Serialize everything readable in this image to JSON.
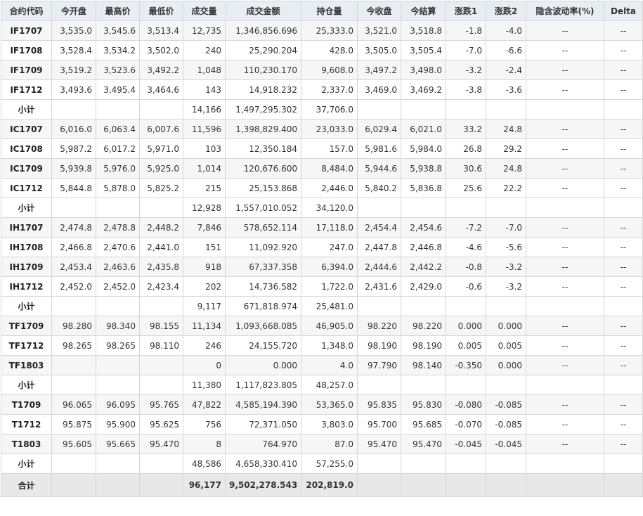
{
  "headers": [
    "合约代码",
    "今开盘",
    "最高价",
    "最低价",
    "成交量",
    "成交金额",
    "持仓量",
    "今收盘",
    "今结算",
    "涨跌1",
    "涨跌2",
    "隐含波动率(%)",
    "Delta"
  ],
  "rows": [
    {
      "kind": "data",
      "cells": [
        "IF1707",
        "3,535.0",
        "3,545.6",
        "3,513.4",
        "12,735",
        "1,346,856.696",
        "25,333.0",
        "3,521.0",
        "3,518.8",
        "-1.8",
        "-4.0",
        "--",
        "--"
      ]
    },
    {
      "kind": "data",
      "cells": [
        "IF1708",
        "3,528.4",
        "3,534.2",
        "3,502.0",
        "240",
        "25,290.204",
        "428.0",
        "3,505.0",
        "3,505.4",
        "-7.0",
        "-6.6",
        "--",
        "--"
      ]
    },
    {
      "kind": "data",
      "cells": [
        "IF1709",
        "3,519.2",
        "3,523.6",
        "3,492.2",
        "1,048",
        "110,230.170",
        "9,608.0",
        "3,497.2",
        "3,498.0",
        "-3.2",
        "-2.4",
        "--",
        "--"
      ]
    },
    {
      "kind": "data",
      "cells": [
        "IF1712",
        "3,493.6",
        "3,495.4",
        "3,464.6",
        "143",
        "14,918.232",
        "2,337.0",
        "3,469.0",
        "3,469.2",
        "-3.8",
        "-3.6",
        "--",
        "--"
      ]
    },
    {
      "kind": "subtotal",
      "cells": [
        "小计",
        "",
        "",
        "",
        "14,166",
        "1,497,295.302",
        "37,706.0",
        "",
        "",
        "",
        "",
        "",
        ""
      ]
    },
    {
      "kind": "data",
      "cells": [
        "IC1707",
        "6,016.0",
        "6,063.4",
        "6,007.6",
        "11,596",
        "1,398,829.400",
        "23,033.0",
        "6,029.4",
        "6,021.0",
        "33.2",
        "24.8",
        "--",
        "--"
      ]
    },
    {
      "kind": "data",
      "cells": [
        "IC1708",
        "5,987.2",
        "6,017.2",
        "5,971.0",
        "103",
        "12,350.184",
        "157.0",
        "5,981.6",
        "5,984.0",
        "26.8",
        "29.2",
        "--",
        "--"
      ]
    },
    {
      "kind": "data",
      "cells": [
        "IC1709",
        "5,939.8",
        "5,976.0",
        "5,925.0",
        "1,014",
        "120,676.600",
        "8,484.0",
        "5,944.6",
        "5,938.8",
        "30.6",
        "24.8",
        "--",
        "--"
      ]
    },
    {
      "kind": "data",
      "cells": [
        "IC1712",
        "5,844.8",
        "5,878.0",
        "5,825.2",
        "215",
        "25,153.868",
        "2,446.0",
        "5,840.2",
        "5,836.8",
        "25.6",
        "22.2",
        "--",
        "--"
      ]
    },
    {
      "kind": "subtotal",
      "cells": [
        "小计",
        "",
        "",
        "",
        "12,928",
        "1,557,010.052",
        "34,120.0",
        "",
        "",
        "",
        "",
        "",
        ""
      ]
    },
    {
      "kind": "data",
      "cells": [
        "IH1707",
        "2,474.8",
        "2,478.8",
        "2,448.2",
        "7,846",
        "578,652.114",
        "17,118.0",
        "2,454.4",
        "2,454.6",
        "-7.2",
        "-7.0",
        "--",
        "--"
      ]
    },
    {
      "kind": "data",
      "cells": [
        "IH1708",
        "2,466.8",
        "2,470.6",
        "2,441.0",
        "151",
        "11,092.920",
        "247.0",
        "2,447.8",
        "2,446.8",
        "-4.6",
        "-5.6",
        "--",
        "--"
      ]
    },
    {
      "kind": "data",
      "cells": [
        "IH1709",
        "2,453.4",
        "2,463.6",
        "2,435.8",
        "918",
        "67,337.358",
        "6,394.0",
        "2,444.6",
        "2,442.2",
        "-0.8",
        "-3.2",
        "--",
        "--"
      ]
    },
    {
      "kind": "data",
      "cells": [
        "IH1712",
        "2,452.0",
        "2,452.0",
        "2,423.4",
        "202",
        "14,736.582",
        "1,722.0",
        "2,431.6",
        "2,429.0",
        "-0.6",
        "-3.2",
        "--",
        "--"
      ]
    },
    {
      "kind": "subtotal",
      "cells": [
        "小计",
        "",
        "",
        "",
        "9,117",
        "671,818.974",
        "25,481.0",
        "",
        "",
        "",
        "",
        "",
        ""
      ]
    },
    {
      "kind": "data",
      "cells": [
        "TF1709",
        "98.280",
        "98.340",
        "98.155",
        "11,134",
        "1,093,668.085",
        "46,905.0",
        "98.220",
        "98.220",
        "0.000",
        "0.000",
        "--",
        "--"
      ]
    },
    {
      "kind": "data",
      "cells": [
        "TF1712",
        "98.265",
        "98.265",
        "98.110",
        "246",
        "24,155.720",
        "1,348.0",
        "98.190",
        "98.190",
        "0.005",
        "0.005",
        "--",
        "--"
      ]
    },
    {
      "kind": "data",
      "cells": [
        "TF1803",
        "",
        "",
        "",
        "0",
        "0.000",
        "4.0",
        "97.790",
        "98.140",
        "-0.350",
        "0.000",
        "--",
        "--"
      ]
    },
    {
      "kind": "subtotal",
      "cells": [
        "小计",
        "",
        "",
        "",
        "11,380",
        "1,117,823.805",
        "48,257.0",
        "",
        "",
        "",
        "",
        "",
        ""
      ]
    },
    {
      "kind": "data",
      "cells": [
        "T1709",
        "96.065",
        "96.095",
        "95.765",
        "47,822",
        "4,585,194.390",
        "53,365.0",
        "95.835",
        "95.830",
        "-0.080",
        "-0.085",
        "--",
        "--"
      ]
    },
    {
      "kind": "data",
      "cells": [
        "T1712",
        "95.875",
        "95.900",
        "95.625",
        "756",
        "72,371.050",
        "3,803.0",
        "95.700",
        "95.685",
        "-0.070",
        "-0.085",
        "--",
        "--"
      ]
    },
    {
      "kind": "data",
      "cells": [
        "T1803",
        "95.605",
        "95.665",
        "95.470",
        "8",
        "764.970",
        "87.0",
        "95.470",
        "95.470",
        "-0.045",
        "-0.045",
        "--",
        "--"
      ]
    },
    {
      "kind": "subtotal",
      "cells": [
        "小计",
        "",
        "",
        "",
        "48,586",
        "4,658,330.410",
        "57,255.0",
        "",
        "",
        "",
        "",
        "",
        ""
      ]
    },
    {
      "kind": "total",
      "cells": [
        "合计",
        "",
        "",
        "",
        "96,177",
        "9,502,278.543",
        "202,819.0",
        "",
        "",
        "",
        "",
        "",
        ""
      ]
    }
  ]
}
